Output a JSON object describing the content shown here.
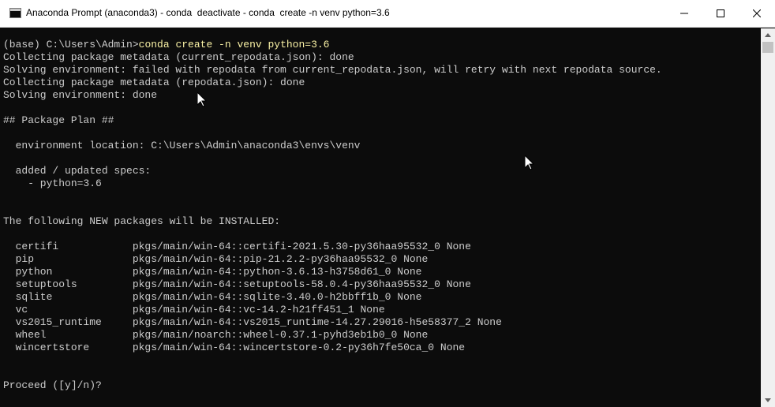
{
  "window": {
    "title": "Anaconda Prompt (anaconda3) - conda  deactivate - conda  create -n venv python=3.6",
    "controls": {
      "minimize": "minimize-icon",
      "maximize": "maximize-icon",
      "close": "close-icon"
    }
  },
  "console": {
    "prompt": "(base) C:\\Users\\Admin>",
    "command": "conda create -n venv python=3.6",
    "lines": [
      "Collecting package metadata (current_repodata.json): done",
      "Solving environment: failed with repodata from current_repodata.json, will retry with next repodata source.",
      "Collecting package metadata (repodata.json): done",
      "Solving environment: done",
      "",
      "## Package Plan ##",
      "",
      "  environment location: C:\\Users\\Admin\\anaconda3\\envs\\venv",
      "",
      "  added / updated specs:",
      "    - python=3.6",
      "",
      "",
      "The following NEW packages will be INSTALLED:",
      "",
      "  certifi            pkgs/main/win-64::certifi-2021.5.30-py36haa95532_0 None",
      "  pip                pkgs/main/win-64::pip-21.2.2-py36haa95532_0 None",
      "  python             pkgs/main/win-64::python-3.6.13-h3758d61_0 None",
      "  setuptools         pkgs/main/win-64::setuptools-58.0.4-py36haa95532_0 None",
      "  sqlite             pkgs/main/win-64::sqlite-3.40.0-h2bbff1b_0 None",
      "  vc                 pkgs/main/win-64::vc-14.2-h21ff451_1 None",
      "  vs2015_runtime     pkgs/main/win-64::vs2015_runtime-14.27.29016-h5e58377_2 None",
      "  wheel              pkgs/main/noarch::wheel-0.37.1-pyhd3eb1b0_0 None",
      "  wincertstore       pkgs/main/win-64::wincertstore-0.2-py36h7fe50ca_0 None",
      "",
      "",
      "Proceed ([y]/n)?"
    ]
  },
  "colors": {
    "background": "#0c0c0c",
    "text": "#cccccc",
    "command": "#f9f1a5"
  }
}
